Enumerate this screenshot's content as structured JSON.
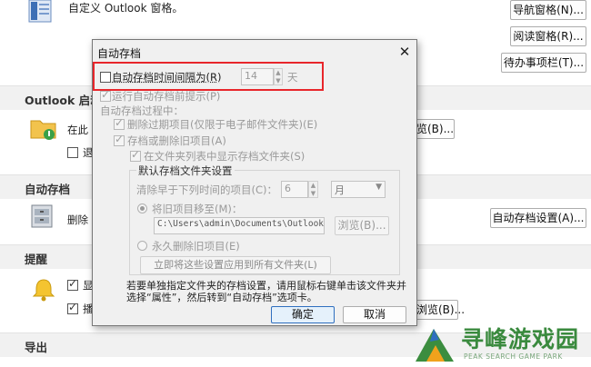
{
  "background": {
    "top_text": "自定义 Outlook 窗格。",
    "buttons": {
      "nav_pane": "导航窗格(N)...",
      "reading_pane": "阅读窗格(R)...",
      "todo_bar": "待办事项栏(T)..."
    },
    "sections": {
      "outlook_start": "Outlook 启动",
      "autoarchive": "自动存档",
      "reminders": "提醒",
      "export": "导出"
    },
    "start_row_text": "在此",
    "start_row_sub": "退",
    "start_browse_btn": "览(B)...",
    "autoarchive_row_text": "删除",
    "autoarchive_settings_btn": "自动存档设置(A)...",
    "reminder_row1": "显",
    "reminder_row2": "播",
    "reminder_browse_btn": "浏览(B)..."
  },
  "dialog": {
    "title": "自动存档",
    "interval_label": "自动存档时间间隔为(R)",
    "interval_value": "14",
    "interval_unit": "天",
    "prompt_label": "运行自动存档前提示(P)",
    "during_label": "自动存档过程中：",
    "delete_expired_label": "删除过期项目(仅限于电子邮件文件夹)(E)",
    "archive_or_delete_label": "存档或删除旧项目(A)",
    "show_folder_label": "在文件夹列表中显示存档文件夹(S)",
    "defaults_group_title": "默认存档文件夹设置",
    "clean_older_label": "清除早于下列时间的项目(C)：",
    "clean_value": "6",
    "clean_unit": "月",
    "move_to_label": "将旧项目移至(M)：",
    "path_value": "C:\\Users\\admin\\Documents\\Outlook",
    "browse_label": "浏览(B)...",
    "perm_delete_label": "永久删除旧项目(E)",
    "apply_all_label": "立即将这些设置应用到所有文件夹(L)",
    "hint_text": "若要单独指定文件夹的存档设置，请用鼠标右键单击该文件夹并选择“属性”，然后转到“自动存档”选项卡。",
    "ok_label": "确定",
    "cancel_label": "取消"
  },
  "watermark": {
    "name": "寻峰游戏园",
    "sub": "PEAK SEARCH GAME PARK"
  },
  "colors": {
    "highlight": "#e8262b",
    "accent_blue": "#2f6fbf"
  }
}
